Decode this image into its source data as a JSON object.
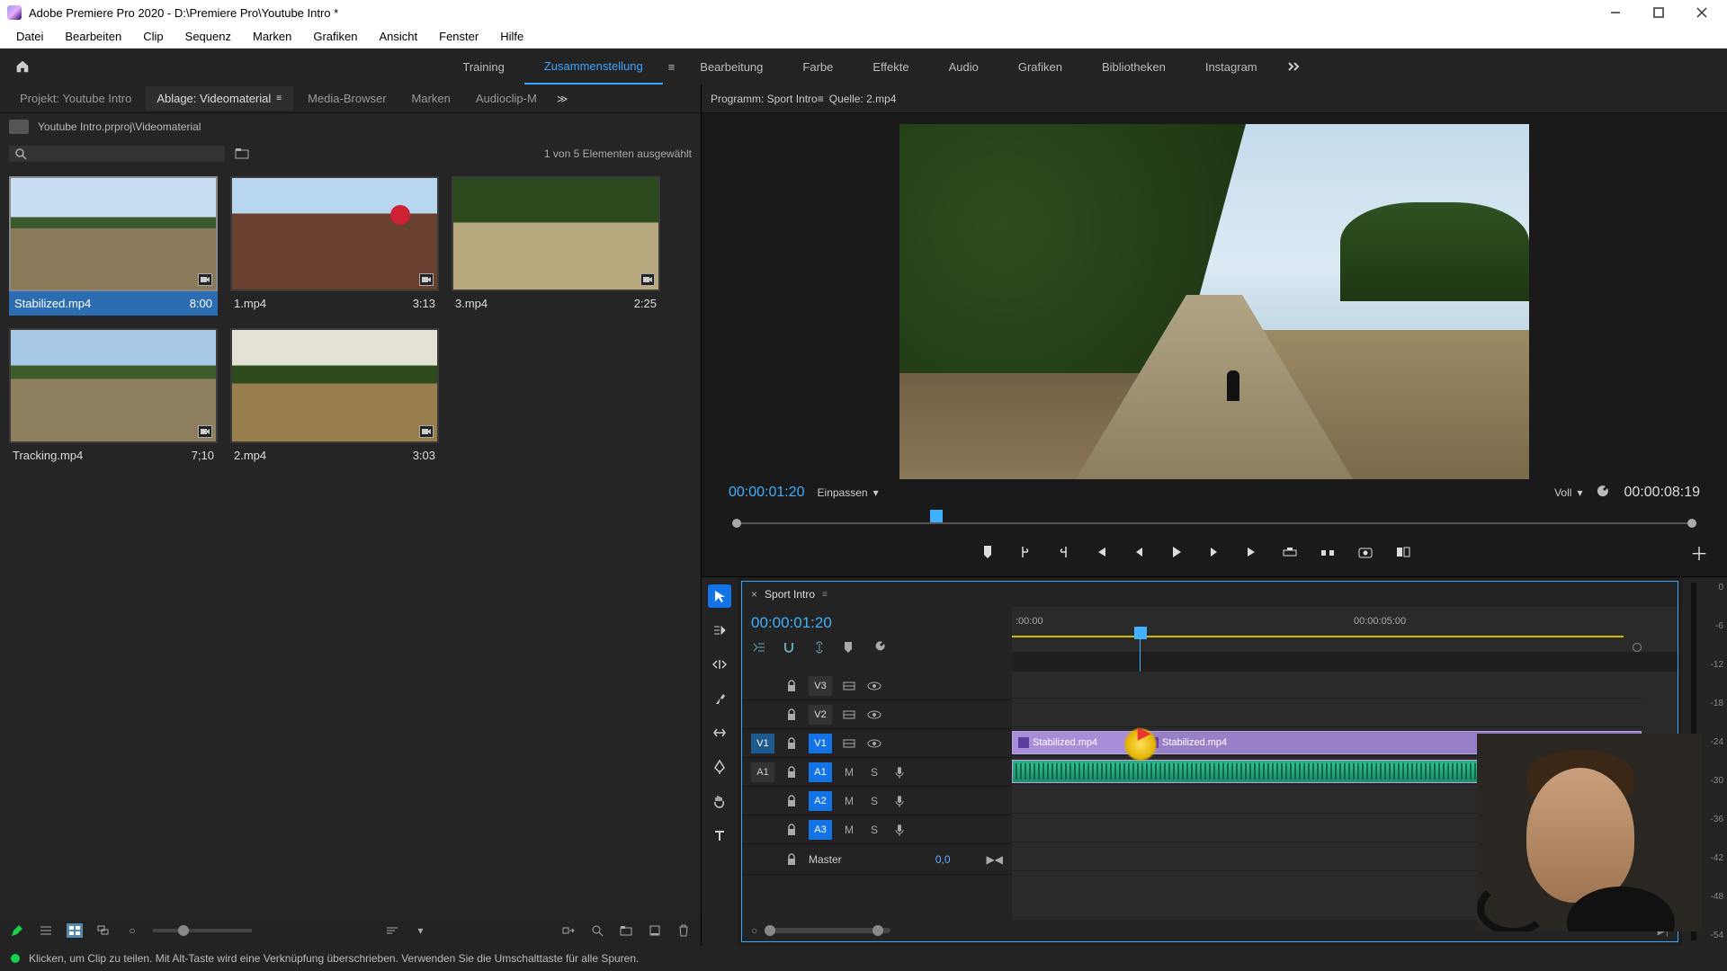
{
  "titlebar": {
    "title": "Adobe Premiere Pro 2020 - D:\\Premiere Pro\\Youtube Intro *"
  },
  "menu": {
    "items": [
      "Datei",
      "Bearbeiten",
      "Clip",
      "Sequenz",
      "Marken",
      "Grafiken",
      "Ansicht",
      "Fenster",
      "Hilfe"
    ]
  },
  "workspace": {
    "tabs": [
      "Training",
      "Zusammenstellung",
      "Bearbeitung",
      "Farbe",
      "Effekte",
      "Audio",
      "Grafiken",
      "Bibliotheken",
      "Instagram"
    ],
    "active_index": 1
  },
  "left_tabs": {
    "items": [
      {
        "label": "Projekt: Youtube Intro"
      },
      {
        "label": "Ablage: Videomaterial",
        "active": true
      },
      {
        "label": "Media-Browser"
      },
      {
        "label": "Marken"
      },
      {
        "label": "Audioclip-M"
      }
    ]
  },
  "project": {
    "breadcrumb": "Youtube Intro.prproj\\Videomaterial",
    "search_placeholder": "",
    "selection_text": "1 von 5 Elementen ausgewählt",
    "clips": [
      {
        "name": "Stabilized.mp4",
        "dur": "8:00",
        "selected": true,
        "scene": "scene1"
      },
      {
        "name": "1.mp4",
        "dur": "3:13",
        "scene": "scene2"
      },
      {
        "name": "3.mp4",
        "dur": "2:25",
        "scene": "scene3"
      },
      {
        "name": "Tracking.mp4",
        "dur": "7;10",
        "scene": "scene4"
      },
      {
        "name": "2.mp4",
        "dur": "3:03",
        "scene": "scene5"
      }
    ]
  },
  "program_tabs": {
    "items": [
      {
        "label": "Programm: Sport Intro",
        "active": true
      },
      {
        "label": "Quelle: 2.mp4"
      }
    ]
  },
  "monitor": {
    "tc_left": "00:00:01:20",
    "fit_label": "Einpassen",
    "quality_label": "Voll",
    "tc_right": "00:00:08:19"
  },
  "timeline": {
    "name": "Sport Intro",
    "tc": "00:00:01:20",
    "ruler": [
      ":00:00",
      "00:00:05:00"
    ],
    "tracks": {
      "video": [
        {
          "tag": "V3"
        },
        {
          "tag": "V2"
        },
        {
          "src": "V1",
          "tag": "V1",
          "src_on": true,
          "tag_on": true
        }
      ],
      "audio": [
        {
          "src": "A1",
          "tag": "A1",
          "tag_on": true
        },
        {
          "tag": "A2",
          "tag_on": true
        },
        {
          "tag": "A3",
          "tag_on": true
        }
      ],
      "master": {
        "label": "Master",
        "value": "0,0"
      }
    },
    "clips": {
      "video_name_a": "Stabilized.mp4",
      "video_name_b": "Stabilized.mp4"
    }
  },
  "meter": {
    "ticks": [
      "0",
      "-6",
      "-12",
      "-18",
      "-24",
      "-30",
      "-36",
      "-42",
      "-48",
      "-54"
    ]
  },
  "status": {
    "hint": "Klicken, um Clip zu teilen. Mit Alt-Taste wird eine Verknüpfung überschrieben. Verwenden Sie die Umschalttaste für alle Spuren."
  }
}
